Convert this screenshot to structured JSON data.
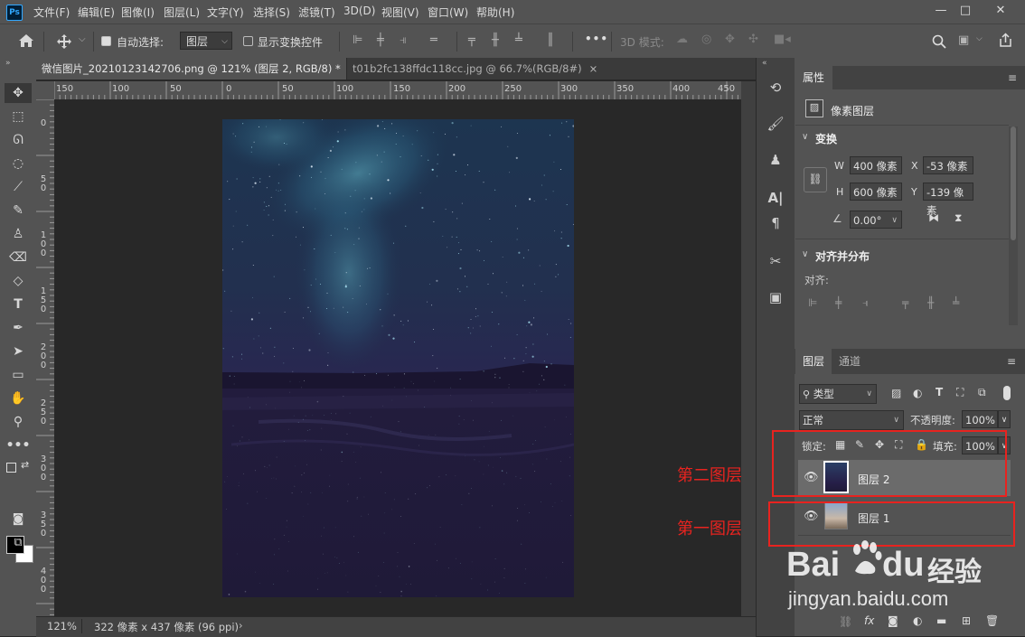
{
  "app": {
    "logo": "Ps"
  },
  "menu": [
    "文件(F)",
    "编辑(E)",
    "图像(I)",
    "图层(L)",
    "文字(Y)",
    "选择(S)",
    "滤镜(T)",
    "3D(D)",
    "视图(V)",
    "窗口(W)",
    "帮助(H)"
  ],
  "window_controls": {
    "minimize": "—",
    "restore": "□",
    "close": "✕"
  },
  "options_bar": {
    "home_icon": "home-icon",
    "move_icon": "move-icon",
    "auto_select_label": "自动选择:",
    "auto_select_checked": true,
    "auto_select_target": "图层",
    "show_transform_label": "显示变换控件",
    "show_transform_checked": false,
    "more": "•••",
    "mode_3d_label": "3D 模式:"
  },
  "tabs": [
    {
      "label": "微信图片_20210123142706.png @ 121% (图层 2, RGB/8) *",
      "close": "×",
      "active": true
    },
    {
      "label": "t01b2fc138ffdc118cc.jpg @ 66.7%(RGB/8#)",
      "close": "×",
      "active": false
    }
  ],
  "ruler": {
    "horizontal": [
      "150",
      "100",
      "50",
      "0",
      "50",
      "100",
      "150",
      "200",
      "250",
      "300",
      "350",
      "400",
      "450"
    ],
    "vertical": [
      "0",
      "50",
      "100",
      "150",
      "200",
      "250",
      "300",
      "350",
      "400",
      "450"
    ]
  },
  "status": {
    "zoom": "121%",
    "doc_info": "322 像素 x 437 像素 (96 ppi)",
    "arrow": "›"
  },
  "properties": {
    "tab": "属性",
    "layer_kind": "像素图层",
    "transform_title": "变换",
    "w_label": "W",
    "w_value": "400 像素",
    "h_label": "H",
    "h_value": "600 像素",
    "x_label": "X",
    "x_value": "-53 像素",
    "y_label": "Y",
    "y_value": "-139 像素",
    "angle_value": "0.00°",
    "align_title": "对齐并分布",
    "align_label": "对齐:"
  },
  "layers_panel": {
    "tab_layers": "图层",
    "tab_channels": "通道",
    "filter_kind": "类型",
    "blend_mode": "正常",
    "opacity_label": "不透明度:",
    "opacity_value": "100%",
    "lock_label": "锁定:",
    "fill_label": "填充:",
    "fill_value": "100%",
    "layers": [
      {
        "name": "图层 2",
        "selected": true
      },
      {
        "name": "图层 1",
        "selected": false
      }
    ]
  },
  "annotations": {
    "second": "第二图层",
    "first": "第一图层",
    "color": "#e8231f"
  },
  "watermark": {
    "brand": "Bai",
    "brand2": "du",
    "cn": "经验",
    "url": "jingyan.baidu.com"
  }
}
